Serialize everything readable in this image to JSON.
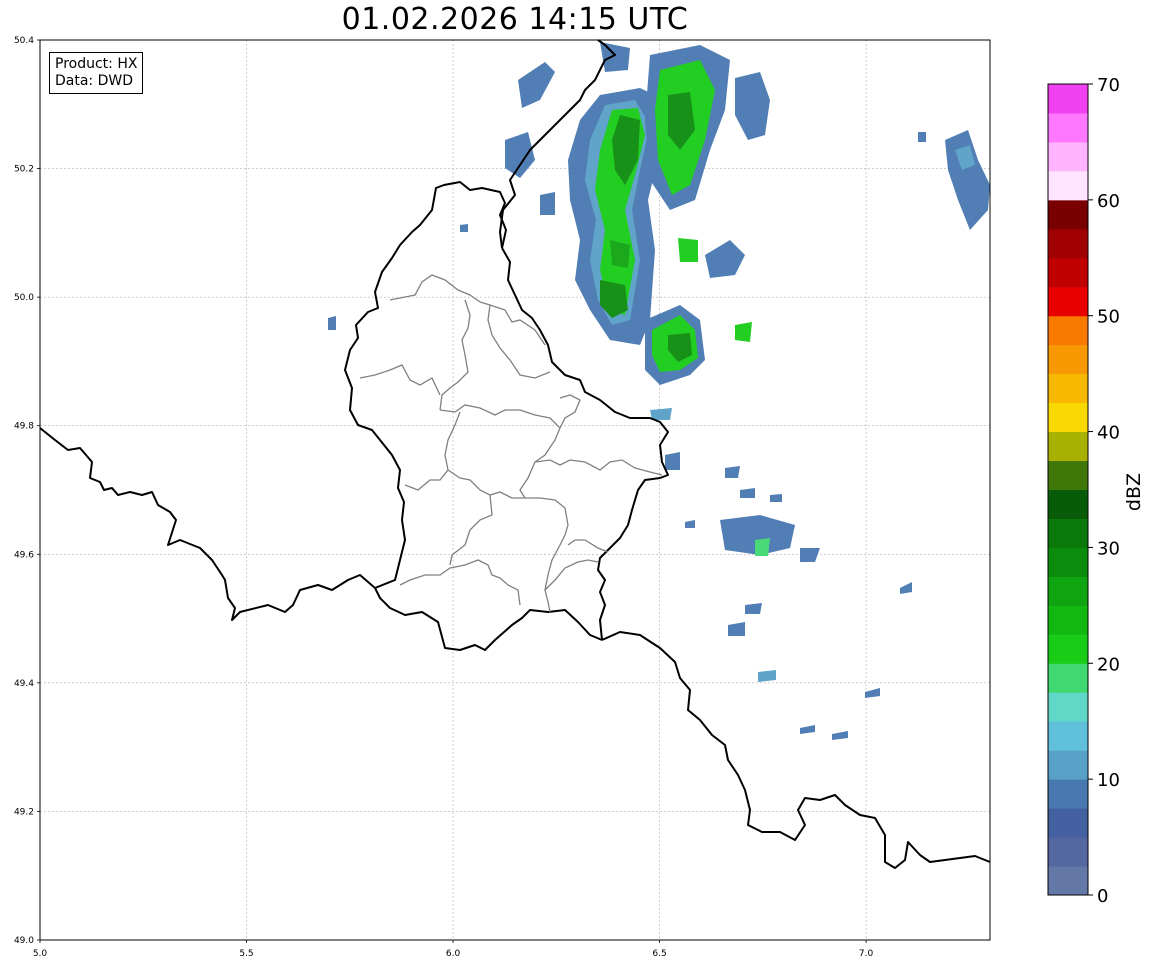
{
  "title": "01.02.2026 14:15 UTC",
  "info": {
    "product": "Product: HX",
    "source": "Data: DWD"
  },
  "axes": {
    "x_ticks": [
      "5.0",
      "5.5",
      "6.0",
      "6.5",
      "7.0"
    ],
    "y_ticks": [
      "50.4",
      "50.2",
      "50.0",
      "49.8",
      "49.6",
      "49.4",
      "49.2",
      "49.0"
    ],
    "lon_range": [
      5.0,
      7.3
    ],
    "lat_range": [
      49.0,
      50.4
    ],
    "grid": true
  },
  "colorbar": {
    "label": "dBZ",
    "tick_labels": [
      "0",
      "10",
      "20",
      "30",
      "40",
      "50",
      "60",
      "70"
    ],
    "colors": [
      "#6478a8",
      "#5468a0",
      "#4460a0",
      "#4878b0",
      "#58a0c8",
      "#60c0dc",
      "#60d8c8",
      "#40d870",
      "#18cc18",
      "#10b810",
      "#10a410",
      "#0c8c0c",
      "#0a780a",
      "#085c08",
      "#407808",
      "#a8b000",
      "#f8d800",
      "#f8b800",
      "#f89800",
      "#f87800",
      "#e80000",
      "#c00000",
      "#a00000",
      "#780000",
      "#ffe4ff",
      "#ffb4ff",
      "#ff78ff",
      "#f040f0"
    ],
    "range": [
      0,
      70
    ]
  }
}
